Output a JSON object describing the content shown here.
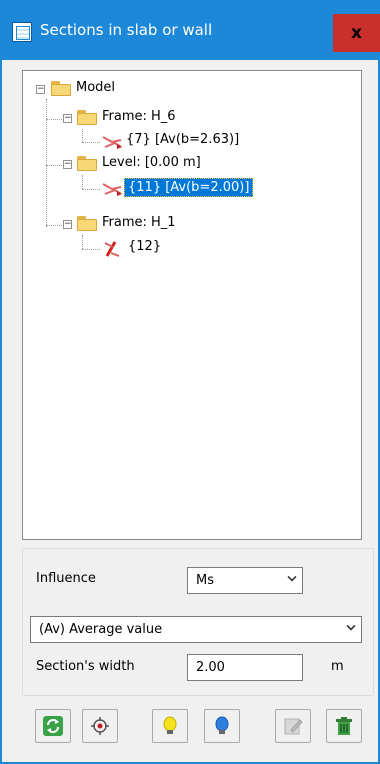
{
  "window": {
    "title": "Sections in slab or wall",
    "close_label": "x"
  },
  "tree": {
    "root": {
      "label": "Model"
    },
    "groups": [
      {
        "label": "Frame: H_6",
        "child": {
          "label": "{7} [Av(b=2.63)]",
          "selected": false
        }
      },
      {
        "label": "Level: [0.00 m]",
        "child": {
          "label": "{11} [Av(b=2.00)]",
          "selected": true
        }
      },
      {
        "label": "Frame: H_1",
        "child": {
          "label": "{12}",
          "selected": false
        }
      }
    ]
  },
  "form": {
    "influence_label": "Influence",
    "influence_value": "Ms",
    "method_value": "(Av) Average value",
    "width_label": "Section's width",
    "width_value": "2.00",
    "width_unit": "m"
  },
  "toolbar": {
    "buttons": [
      {
        "icon": "refresh-icon"
      },
      {
        "icon": "target-icon"
      },
      {
        "icon": "yellow-bulb-icon"
      },
      {
        "icon": "blue-bulb-icon"
      },
      {
        "icon": "edit-icon"
      },
      {
        "icon": "trash-icon"
      }
    ]
  },
  "colors": {
    "titlebar": "#1e88d8",
    "close": "#c9302c",
    "selection": "#0078d7"
  }
}
